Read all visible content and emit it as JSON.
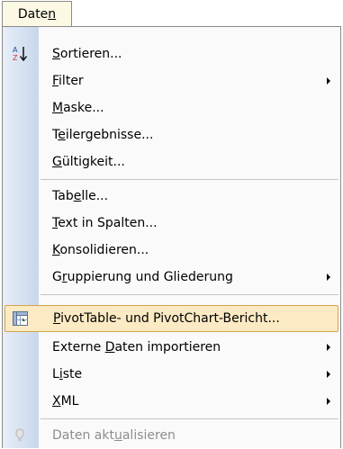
{
  "menubar": {
    "title": "Daten",
    "title_html_underline": "n"
  },
  "menu": {
    "items": [
      {
        "label_pre": "",
        "mnemonic": "S",
        "label_post": "ortieren...",
        "has_submenu": false,
        "icon": "sort-az-icon"
      },
      {
        "label_pre": "",
        "mnemonic": "F",
        "label_post": "ilter",
        "has_submenu": true
      },
      {
        "label_pre": "",
        "mnemonic": "M",
        "label_post": "aske...",
        "has_submenu": false
      },
      {
        "label_pre": "T",
        "mnemonic": "e",
        "label_post": "ilergebnisse...",
        "has_submenu": false
      },
      {
        "label_pre": "",
        "mnemonic": "G",
        "label_post": "ültigkeit...",
        "has_submenu": false
      },
      {
        "label_pre": "Tab",
        "mnemonic": "e",
        "label_post": "lle...",
        "has_submenu": false
      },
      {
        "label_pre": "",
        "mnemonic": "T",
        "label_post": "ext in Spalten...",
        "has_submenu": false
      },
      {
        "label_pre": "",
        "mnemonic": "K",
        "label_post": "onsolidieren...",
        "has_submenu": false
      },
      {
        "label_pre": "G",
        "mnemonic": "r",
        "label_post": "uppierung und Gliederung",
        "has_submenu": true
      },
      {
        "label_pre": "",
        "mnemonic": "P",
        "label_post": "ivotTable- und PivotChart-Bericht...",
        "has_submenu": false,
        "icon": "pivot-table-icon",
        "highlighted": true
      },
      {
        "label_pre": "Externe ",
        "mnemonic": "D",
        "label_post": "aten importieren",
        "has_submenu": true
      },
      {
        "label_pre": "L",
        "mnemonic": "i",
        "label_post": "ste",
        "has_submenu": true
      },
      {
        "label_pre": "",
        "mnemonic": "X",
        "label_post": "ML",
        "has_submenu": true
      },
      {
        "label_pre": "Daten akt",
        "mnemonic": "u",
        "label_post": "alisieren",
        "has_submenu": false,
        "icon": "refresh-icon",
        "disabled": true
      }
    ]
  }
}
